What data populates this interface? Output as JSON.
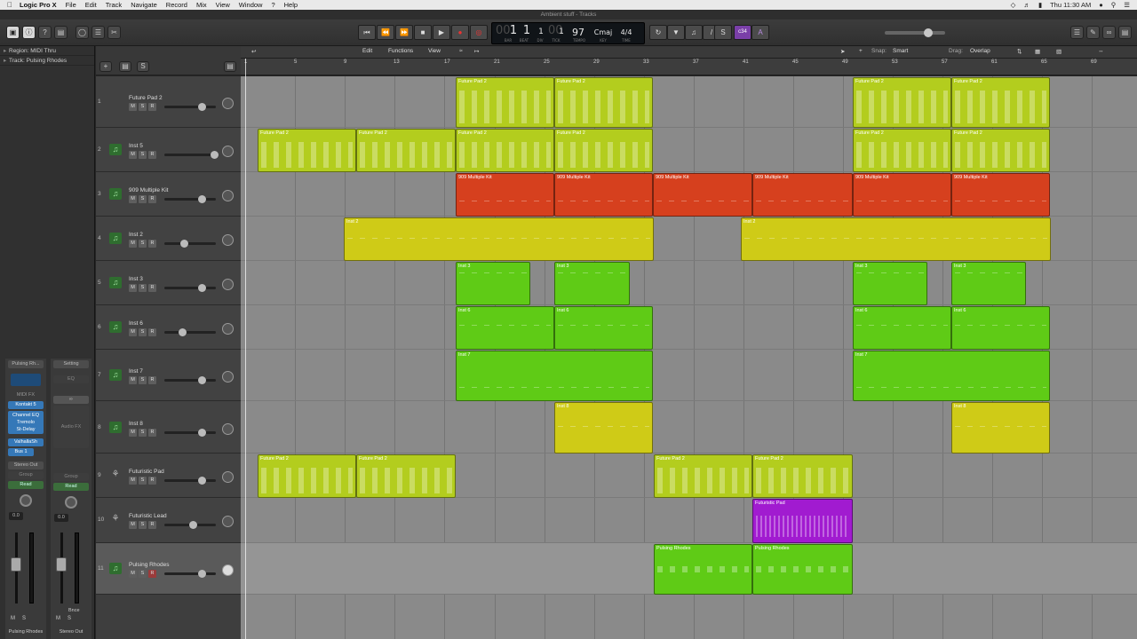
{
  "menubar": {
    "app_name": "Logic Pro X",
    "items": [
      "File",
      "Edit",
      "Track",
      "Navigate",
      "Record",
      "Mix",
      "View",
      "Window",
      "?",
      "Help"
    ],
    "clock": "Thu 11:30 AM"
  },
  "window": {
    "title": "Ambient stuff - Tracks"
  },
  "lcd": {
    "bar": "1",
    "beat": "1",
    "div": "1",
    "tick": "1",
    "tempo": "97",
    "key": "Cmaj",
    "signature": "4/4",
    "labels": [
      "BAR",
      "BEAT",
      "DIV",
      "TICK",
      "TEMPO",
      "KEY",
      "TIME"
    ]
  },
  "toolbar": {
    "badge1": "c34",
    "badge2": "A"
  },
  "inspector": {
    "region_label": "Region: MIDI Thru",
    "track_label": "Track: Pulsing Rhodes",
    "strip1": {
      "name": "Pulsing Rh...",
      "midi_fx": "MIDI FX",
      "instrument": "Kontakt 5",
      "plugins": [
        "Channel EQ",
        "Tremolo",
        "St-Delay"
      ],
      "send_plugin": "ValhallaSh",
      "bus": "Bus 1",
      "output": "Stereo Out",
      "group": "Group",
      "automation": "Read",
      "volume": "0.0",
      "m": "M",
      "s": "S",
      "footer": "Pulsing Rhodes"
    },
    "strip2": {
      "setting": "Setting",
      "eq": "EQ",
      "audio_fx": "Audio FX",
      "group": "Group",
      "automation": "Read",
      "volume": "0.0",
      "bounce": "Bnce",
      "m": "M",
      "s": "S",
      "footer": "Stereo Out"
    }
  },
  "edit_menu": {
    "edit": "Edit",
    "functions": "Functions",
    "view": "View",
    "snap_label": "Snap:",
    "snap_value": "Smart",
    "drag_label": "Drag:",
    "drag_value": "Overlap"
  },
  "ruler": [
    "1",
    "5",
    "9",
    "13",
    "17",
    "21",
    "25",
    "29",
    "33",
    "37",
    "41",
    "45",
    "49",
    "53",
    "57",
    "61",
    "65",
    "69"
  ],
  "tracks": [
    {
      "num": "1",
      "name": "Future Pad 2"
    },
    {
      "num": "2",
      "name": "Inst 5"
    },
    {
      "num": "3",
      "name": "909 Multiple Kit"
    },
    {
      "num": "4",
      "name": "Inst 2"
    },
    {
      "num": "5",
      "name": "Inst 3"
    },
    {
      "num": "6",
      "name": "Inst 6"
    },
    {
      "num": "7",
      "name": "Inst 7"
    },
    {
      "num": "8",
      "name": "Inst 8"
    },
    {
      "num": "9",
      "name": "Futuristic Pad"
    },
    {
      "num": "10",
      "name": "Futuristic Lead"
    },
    {
      "num": "11",
      "name": "Pulsing Rhodes"
    }
  ],
  "track_buttons": {
    "m": "M",
    "s": "S",
    "r": "R"
  },
  "colors": {
    "yellow_green": "#b3cd1e",
    "red": "#d6401e",
    "yellow": "#cfcb17",
    "green": "#5fcb16",
    "purple": "#a11bd0"
  },
  "regions": {
    "future_pad_2": "Future Pad 2",
    "kit": "909 Multiple Kit",
    "inst2": "Inst 2",
    "inst3": "Inst 3",
    "inst6": "Inst 6",
    "inst7": "Inst 7",
    "inst8": "Inst 8",
    "futuristic_pad": "Futuristic Pad",
    "pulsing_rhodes": "Pulsing Rhodes"
  }
}
